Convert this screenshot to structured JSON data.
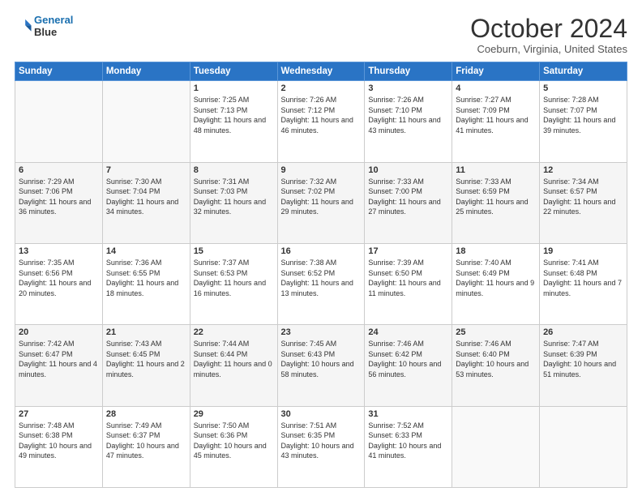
{
  "header": {
    "logo_line1": "General",
    "logo_line2": "Blue",
    "month": "October 2024",
    "location": "Coeburn, Virginia, United States"
  },
  "weekdays": [
    "Sunday",
    "Monday",
    "Tuesday",
    "Wednesday",
    "Thursday",
    "Friday",
    "Saturday"
  ],
  "weeks": [
    [
      {
        "day": "",
        "sunrise": "",
        "sunset": "",
        "daylight": ""
      },
      {
        "day": "",
        "sunrise": "",
        "sunset": "",
        "daylight": ""
      },
      {
        "day": "1",
        "sunrise": "Sunrise: 7:25 AM",
        "sunset": "Sunset: 7:13 PM",
        "daylight": "Daylight: 11 hours and 48 minutes."
      },
      {
        "day": "2",
        "sunrise": "Sunrise: 7:26 AM",
        "sunset": "Sunset: 7:12 PM",
        "daylight": "Daylight: 11 hours and 46 minutes."
      },
      {
        "day": "3",
        "sunrise": "Sunrise: 7:26 AM",
        "sunset": "Sunset: 7:10 PM",
        "daylight": "Daylight: 11 hours and 43 minutes."
      },
      {
        "day": "4",
        "sunrise": "Sunrise: 7:27 AM",
        "sunset": "Sunset: 7:09 PM",
        "daylight": "Daylight: 11 hours and 41 minutes."
      },
      {
        "day": "5",
        "sunrise": "Sunrise: 7:28 AM",
        "sunset": "Sunset: 7:07 PM",
        "daylight": "Daylight: 11 hours and 39 minutes."
      }
    ],
    [
      {
        "day": "6",
        "sunrise": "Sunrise: 7:29 AM",
        "sunset": "Sunset: 7:06 PM",
        "daylight": "Daylight: 11 hours and 36 minutes."
      },
      {
        "day": "7",
        "sunrise": "Sunrise: 7:30 AM",
        "sunset": "Sunset: 7:04 PM",
        "daylight": "Daylight: 11 hours and 34 minutes."
      },
      {
        "day": "8",
        "sunrise": "Sunrise: 7:31 AM",
        "sunset": "Sunset: 7:03 PM",
        "daylight": "Daylight: 11 hours and 32 minutes."
      },
      {
        "day": "9",
        "sunrise": "Sunrise: 7:32 AM",
        "sunset": "Sunset: 7:02 PM",
        "daylight": "Daylight: 11 hours and 29 minutes."
      },
      {
        "day": "10",
        "sunrise": "Sunrise: 7:33 AM",
        "sunset": "Sunset: 7:00 PM",
        "daylight": "Daylight: 11 hours and 27 minutes."
      },
      {
        "day": "11",
        "sunrise": "Sunrise: 7:33 AM",
        "sunset": "Sunset: 6:59 PM",
        "daylight": "Daylight: 11 hours and 25 minutes."
      },
      {
        "day": "12",
        "sunrise": "Sunrise: 7:34 AM",
        "sunset": "Sunset: 6:57 PM",
        "daylight": "Daylight: 11 hours and 22 minutes."
      }
    ],
    [
      {
        "day": "13",
        "sunrise": "Sunrise: 7:35 AM",
        "sunset": "Sunset: 6:56 PM",
        "daylight": "Daylight: 11 hours and 20 minutes."
      },
      {
        "day": "14",
        "sunrise": "Sunrise: 7:36 AM",
        "sunset": "Sunset: 6:55 PM",
        "daylight": "Daylight: 11 hours and 18 minutes."
      },
      {
        "day": "15",
        "sunrise": "Sunrise: 7:37 AM",
        "sunset": "Sunset: 6:53 PM",
        "daylight": "Daylight: 11 hours and 16 minutes."
      },
      {
        "day": "16",
        "sunrise": "Sunrise: 7:38 AM",
        "sunset": "Sunset: 6:52 PM",
        "daylight": "Daylight: 11 hours and 13 minutes."
      },
      {
        "day": "17",
        "sunrise": "Sunrise: 7:39 AM",
        "sunset": "Sunset: 6:50 PM",
        "daylight": "Daylight: 11 hours and 11 minutes."
      },
      {
        "day": "18",
        "sunrise": "Sunrise: 7:40 AM",
        "sunset": "Sunset: 6:49 PM",
        "daylight": "Daylight: 11 hours and 9 minutes."
      },
      {
        "day": "19",
        "sunrise": "Sunrise: 7:41 AM",
        "sunset": "Sunset: 6:48 PM",
        "daylight": "Daylight: 11 hours and 7 minutes."
      }
    ],
    [
      {
        "day": "20",
        "sunrise": "Sunrise: 7:42 AM",
        "sunset": "Sunset: 6:47 PM",
        "daylight": "Daylight: 11 hours and 4 minutes."
      },
      {
        "day": "21",
        "sunrise": "Sunrise: 7:43 AM",
        "sunset": "Sunset: 6:45 PM",
        "daylight": "Daylight: 11 hours and 2 minutes."
      },
      {
        "day": "22",
        "sunrise": "Sunrise: 7:44 AM",
        "sunset": "Sunset: 6:44 PM",
        "daylight": "Daylight: 11 hours and 0 minutes."
      },
      {
        "day": "23",
        "sunrise": "Sunrise: 7:45 AM",
        "sunset": "Sunset: 6:43 PM",
        "daylight": "Daylight: 10 hours and 58 minutes."
      },
      {
        "day": "24",
        "sunrise": "Sunrise: 7:46 AM",
        "sunset": "Sunset: 6:42 PM",
        "daylight": "Daylight: 10 hours and 56 minutes."
      },
      {
        "day": "25",
        "sunrise": "Sunrise: 7:46 AM",
        "sunset": "Sunset: 6:40 PM",
        "daylight": "Daylight: 10 hours and 53 minutes."
      },
      {
        "day": "26",
        "sunrise": "Sunrise: 7:47 AM",
        "sunset": "Sunset: 6:39 PM",
        "daylight": "Daylight: 10 hours and 51 minutes."
      }
    ],
    [
      {
        "day": "27",
        "sunrise": "Sunrise: 7:48 AM",
        "sunset": "Sunset: 6:38 PM",
        "daylight": "Daylight: 10 hours and 49 minutes."
      },
      {
        "day": "28",
        "sunrise": "Sunrise: 7:49 AM",
        "sunset": "Sunset: 6:37 PM",
        "daylight": "Daylight: 10 hours and 47 minutes."
      },
      {
        "day": "29",
        "sunrise": "Sunrise: 7:50 AM",
        "sunset": "Sunset: 6:36 PM",
        "daylight": "Daylight: 10 hours and 45 minutes."
      },
      {
        "day": "30",
        "sunrise": "Sunrise: 7:51 AM",
        "sunset": "Sunset: 6:35 PM",
        "daylight": "Daylight: 10 hours and 43 minutes."
      },
      {
        "day": "31",
        "sunrise": "Sunrise: 7:52 AM",
        "sunset": "Sunset: 6:33 PM",
        "daylight": "Daylight: 10 hours and 41 minutes."
      },
      {
        "day": "",
        "sunrise": "",
        "sunset": "",
        "daylight": ""
      },
      {
        "day": "",
        "sunrise": "",
        "sunset": "",
        "daylight": ""
      }
    ]
  ]
}
